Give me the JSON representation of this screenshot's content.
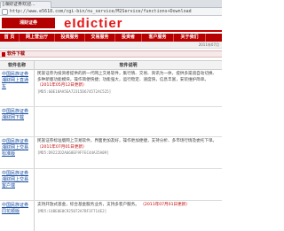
{
  "browser": {
    "tab_title": "[湘财证券欢迎...",
    "url": "http://www.e5618.com/cgi-bin/nu_service/M2Service/functions+Download"
  },
  "banner": {
    "logo_text": "湘财证券",
    "watermark": "eIdictier"
  },
  "nav": {
    "items": [
      "首 页",
      "网上营业厅",
      "投资服务",
      "交易服务",
      "投资者",
      "客户服务",
      "关于我们"
    ]
  },
  "subbar": {
    "date": "2011年07月"
  },
  "section": {
    "title": "软件下载"
  },
  "table": {
    "headers": {
      "name": "软件名称",
      "desc": "软件说明"
    },
    "rows": [
      {
        "name": "中国民族证券湘财网上直通车",
        "desc": "民族证券为投资者提供的新一代网上交易软件，集行情、交易、资讯为一体，提供多渠道自动切换、多种新版功能模块，操作简便快捷；功能强大，运行稳定、速度快，信息丰富，安装维护简单。",
        "date": "（2011年05月12日更新）",
        "md5": "[MD5:60E18AA5EA72315D674572AC525]"
      },
      {
        "name": "中国民族证券湘财网下载",
        "desc": "",
        "date": "",
        "md5": ""
      },
      {
        "name": "中国民族证券湘财网上交易标准版",
        "desc": "民族证券标准版网上交易软件，界面更加友好，操作更加便捷，支持分析、多市场行情及委托下单。",
        "date": "（2011年07月01日更新）",
        "md5": "[MD5:D9222D2A668EF9FFEC44A35A09]"
      },
      {
        "name": "中国民族证券湘财网上交易客户端",
        "desc": "",
        "date": "",
        "md5": ""
      },
      {
        "name": "中国民族证券同花顺版",
        "desc": "支持开放式基金，综合基金服务业务，支持多客户服务。",
        "date": "（2011年07月01日更新）",
        "md5": "[MD5:C4BE0E0C925072A7BF3F714E2]"
      }
    ]
  }
}
